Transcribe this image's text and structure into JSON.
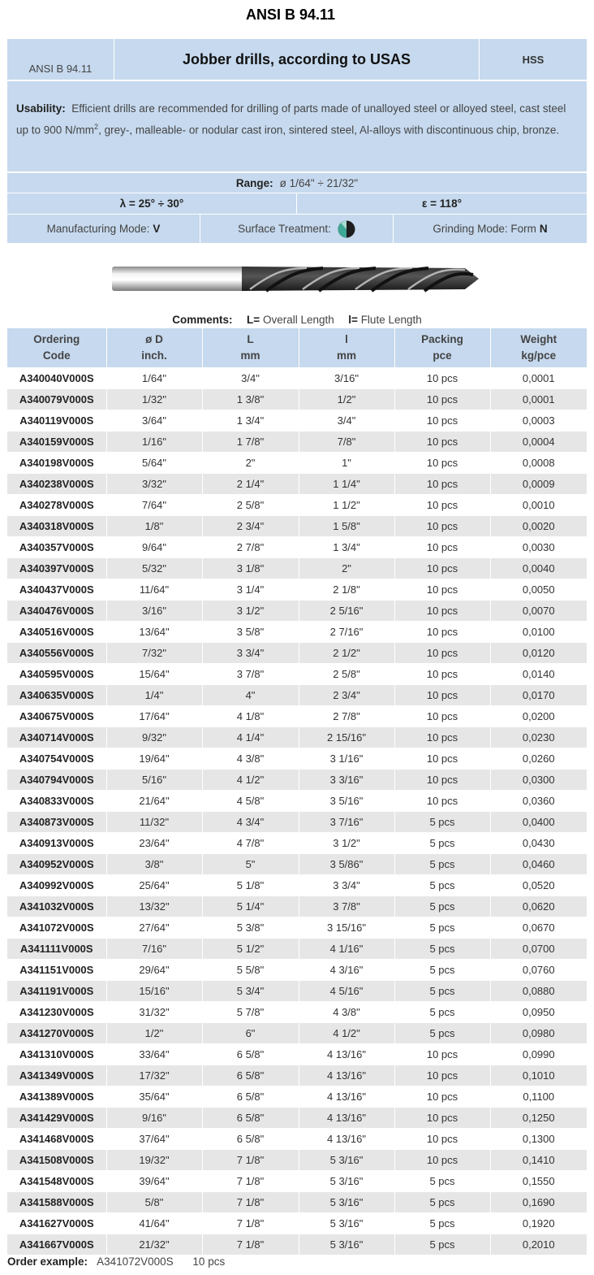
{
  "title": "ANSI B 94.11",
  "header": {
    "standard": "ANSI B 94.11",
    "product": "Jobber drills, according to USAS",
    "material": "HSS",
    "usability_label": "Usability:",
    "usability_text_a": "Efficient drills are recommended for drilling of parts made of unalloyed steel or alloyed steel, cast steel up to 900 N/mm",
    "usability_sup": "2",
    "usability_text_b": ", grey-, malleable- or nodular cast iron, sintered steel, Al-alloys with discontinuous chip, bronze.",
    "range_label": "Range:",
    "range_value": "ø 1/64\" ÷ 21/32\"",
    "lambda": "λ = 25° ÷ 30°",
    "epsilon": "ε = 118°",
    "manufacturing_label": "Manufacturing Mode:",
    "manufacturing_value": "V",
    "surface_label": "Surface Treatment:",
    "surface_icon": "surface-treatment-icon",
    "grinding_label": "Grinding Mode: Form",
    "grinding_value": "N"
  },
  "comments": {
    "label": "Comments:",
    "L_key": "L=",
    "L_text": "Overall Length",
    "l_key": "l=",
    "l_text": "Flute Length"
  },
  "table": {
    "headers": [
      [
        "Ordering",
        "Code"
      ],
      [
        "ø D",
        "inch."
      ],
      [
        "L",
        "mm"
      ],
      [
        "l",
        "mm"
      ],
      [
        "Packing",
        "pce"
      ],
      [
        "Weight",
        "kg/pce"
      ]
    ],
    "rows": [
      [
        "A340040V000S",
        "1/64\"",
        "3/4\"",
        "3/16\"",
        "10 pcs",
        "0,0001"
      ],
      [
        "A340079V000S",
        "1/32\"",
        "1 3/8\"",
        "1/2\"",
        "10 pcs",
        "0,0001"
      ],
      [
        "A340119V000S",
        "3/64\"",
        "1 3/4\"",
        "3/4\"",
        "10 pcs",
        "0,0003"
      ],
      [
        "A340159V000S",
        "1/16\"",
        "1 7/8\"",
        "7/8\"",
        "10 pcs",
        "0,0004"
      ],
      [
        "A340198V000S",
        "5/64\"",
        "2\"",
        "1\"",
        "10 pcs",
        "0,0008"
      ],
      [
        "A340238V000S",
        "3/32\"",
        "2 1/4\"",
        "1 1/4\"",
        "10 pcs",
        "0,0009"
      ],
      [
        "A340278V000S",
        "7/64\"",
        "2 5/8\"",
        "1 1/2\"",
        "10 pcs",
        "0,0010"
      ],
      [
        "A340318V000S",
        "1/8\"",
        "2 3/4\"",
        "1 5/8\"",
        "10 pcs",
        "0,0020"
      ],
      [
        "A340357V000S",
        "9/64\"",
        "2 7/8\"",
        "1 3/4\"",
        "10 pcs",
        "0,0030"
      ],
      [
        "A340397V000S",
        "5/32\"",
        "3 1/8\"",
        "2\"",
        "10 pcs",
        "0,0040"
      ],
      [
        "A340437V000S",
        "11/64\"",
        "3 1/4\"",
        "2 1/8\"",
        "10 pcs",
        "0,0050"
      ],
      [
        "A340476V000S",
        "3/16\"",
        "3 1/2\"",
        "2 5/16\"",
        "10 pcs",
        "0,0070"
      ],
      [
        "A340516V000S",
        "13/64\"",
        "3 5/8\"",
        "2 7/16\"",
        "10 pcs",
        "0,0100"
      ],
      [
        "A340556V000S",
        "7/32\"",
        "3 3/4\"",
        "2 1/2\"",
        "10 pcs",
        "0,0120"
      ],
      [
        "A340595V000S",
        "15/64\"",
        "3 7/8\"",
        "2 5/8\"",
        "10 pcs",
        "0,0140"
      ],
      [
        "A340635V000S",
        "1/4\"",
        "4\"",
        "2 3/4\"",
        "10 pcs",
        "0,0170"
      ],
      [
        "A340675V000S",
        "17/64\"",
        "4 1/8\"",
        "2 7/8\"",
        "10 pcs",
        "0,0200"
      ],
      [
        "A340714V000S",
        "9/32\"",
        "4 1/4\"",
        "2 15/16\"",
        "10 pcs",
        "0,0230"
      ],
      [
        "A340754V000S",
        "19/64\"",
        "4 3/8\"",
        "3 1/16\"",
        "10 pcs",
        "0,0260"
      ],
      [
        "A340794V000S",
        "5/16\"",
        "4 1/2\"",
        "3 3/16\"",
        "10 pcs",
        "0,0300"
      ],
      [
        "A340833V000S",
        "21/64\"",
        "4 5/8\"",
        "3 5/16\"",
        "10 pcs",
        "0,0360"
      ],
      [
        "A340873V000S",
        "11/32\"",
        "4 3/4\"",
        "3 7/16\"",
        "5 pcs",
        "0,0400"
      ],
      [
        "A340913V000S",
        "23/64\"",
        "4 7/8\"",
        "3 1/2\"",
        "5 pcs",
        "0,0430"
      ],
      [
        "A340952V000S",
        "3/8\"",
        "5\"",
        "3 5/86\"",
        "5 pcs",
        "0,0460"
      ],
      [
        "A340992V000S",
        "25/64\"",
        "5 1/8\"",
        "3 3/4\"",
        "5 pcs",
        "0,0520"
      ],
      [
        "A341032V000S",
        "13/32\"",
        "5 1/4\"",
        "3 7/8\"",
        "5 pcs",
        "0,0620"
      ],
      [
        "A341072V000S",
        "27/64\"",
        "5 3/8\"",
        "3 15/16\"",
        "5 pcs",
        "0,0670"
      ],
      [
        "A341111V000S",
        "7/16\"",
        "5 1/2\"",
        "4 1/16\"",
        "5 pcs",
        "0,0700"
      ],
      [
        "A341151V000S",
        "29/64\"",
        "5 5/8\"",
        "4 3/16\"",
        "5 pcs",
        "0,0760"
      ],
      [
        "A341191V000S",
        "15/16\"",
        "5 3/4\"",
        "4 5/16\"",
        "5 pcs",
        "0,0880"
      ],
      [
        "A341230V000S",
        "31/32\"",
        "5 7/8\"",
        "4 3/8\"",
        "5 pcs",
        "0,0950"
      ],
      [
        "A341270V000S",
        "1/2\"",
        "6\"",
        "4 1/2\"",
        "5 pcs",
        "0,0980"
      ],
      [
        "A341310V000S",
        "33/64\"",
        "6 5/8\"",
        "4 13/16\"",
        "10 pcs",
        "0,0990"
      ],
      [
        "A341349V000S",
        "17/32\"",
        "6 5/8\"",
        "4 13/16\"",
        "10 pcs",
        "0,1010"
      ],
      [
        "A341389V000S",
        "35/64\"",
        "6 5/8\"",
        "4 13/16\"",
        "10 pcs",
        "0,1100"
      ],
      [
        "A341429V000S",
        "9/16\"",
        "6 5/8\"",
        "4 13/16\"",
        "10 pcs",
        "0,1250"
      ],
      [
        "A341468V000S",
        "37/64\"",
        "6 5/8\"",
        "4 13/16\"",
        "10 pcs",
        "0,1300"
      ],
      [
        "A341508V000S",
        "19/32\"",
        "7 1/8\"",
        "5 3/16\"",
        "10 pcs",
        "0,1410"
      ],
      [
        "A341548V000S",
        "39/64\"",
        "7 1/8\"",
        "5 3/16\"",
        "5 pcs",
        "0,1550"
      ],
      [
        "A341588V000S",
        "5/8\"",
        "7 1/8\"",
        "5 3/16\"",
        "5 pcs",
        "0,1690"
      ],
      [
        "A341627V000S",
        "41/64\"",
        "7 1/8\"",
        "5 3/16\"",
        "5 pcs",
        "0,1920"
      ],
      [
        "A341667V000S",
        "21/32\"",
        "7 1/8\"",
        "5 3/16\"",
        "5 pcs",
        "0,2010"
      ]
    ]
  },
  "order_example": {
    "label": "Order example:",
    "code": "A341072V000S",
    "packing": "10 pcs"
  },
  "colors": {
    "header_bg": "#c6d9ee",
    "row_alt_bg": "#e6e6e6"
  }
}
